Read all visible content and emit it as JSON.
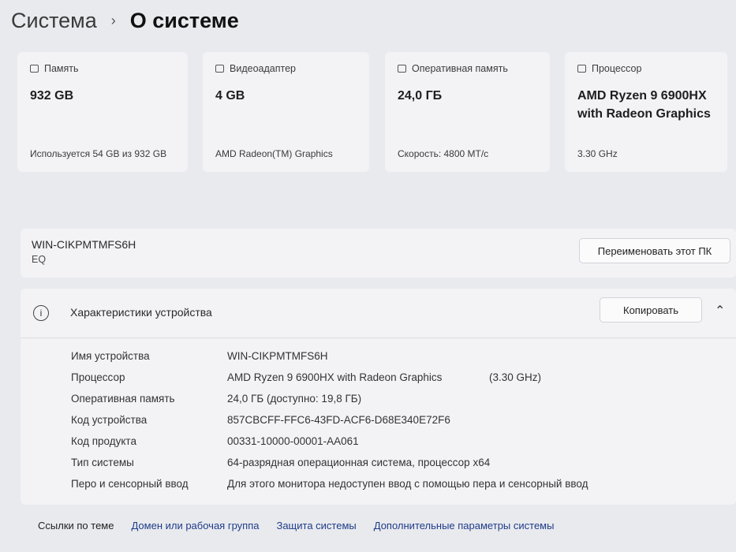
{
  "breadcrumb": {
    "parent": "Система",
    "separator": "›",
    "current": "О системе"
  },
  "cards": [
    {
      "icon": "storage-icon",
      "label": "Память",
      "value": "932 GB",
      "detail": "Используется 54 GB из 932 GB"
    },
    {
      "icon": "gpu-icon",
      "label": "Видеоадаптер",
      "value": "4 GB",
      "detail": "AMD Radeon(TM) Graphics"
    },
    {
      "icon": "ram-icon",
      "label": "Оперативная память",
      "value": "24,0 ГБ",
      "detail": "Скорость: 4800 МТ/с"
    },
    {
      "icon": "cpu-icon",
      "label": "Процессор",
      "value": "AMD Ryzen 9 6900HX with Radeon Graphics",
      "detail": "3.30 GHz"
    }
  ],
  "pc": {
    "name": "WIN-CIKPMTMFS6H",
    "org": "EQ",
    "rename_label": "Переименовать этот ПК"
  },
  "device_specs": {
    "title": "Характеристики устройства",
    "copy_label": "Копировать",
    "rows": [
      {
        "key": "Имя устройства",
        "value": "WIN-CIKPMTMFS6H",
        "extra": ""
      },
      {
        "key": "Процессор",
        "value": "AMD Ryzen 9 6900HX with Radeon Graphics",
        "extra": "(3.30 GHz)"
      },
      {
        "key": "Оперативная память",
        "value": "24,0 ГБ (доступно: 19,8 ГБ)",
        "extra": ""
      },
      {
        "key": "Код устройства",
        "value": "857CBCFF-FFC6-43FD-ACF6-D68E340E72F6",
        "extra": ""
      },
      {
        "key": "Код продукта",
        "value": "00331-10000-00001-AA061",
        "extra": ""
      },
      {
        "key": "Тип системы",
        "value": "64-разрядная операционная система, процессор x64",
        "extra": ""
      },
      {
        "key": "Перо и сенсорный ввод",
        "value": "Для этого монитора недоступен ввод с помощью пера и сенсорный ввод",
        "extra": ""
      }
    ]
  },
  "related_links": {
    "label": "Ссылки по теме",
    "links": [
      "Домен или рабочая группа",
      "Защита системы",
      "Дополнительные параметры системы"
    ]
  }
}
